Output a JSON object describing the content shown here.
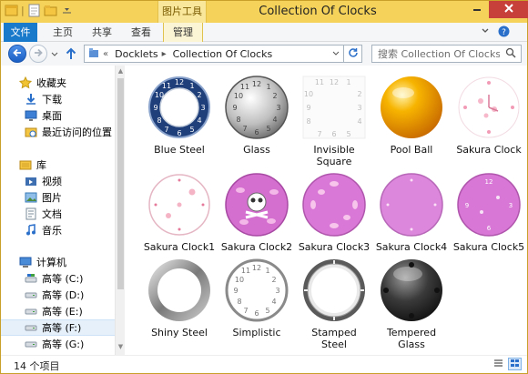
{
  "window": {
    "title": "Collection Of Clocks",
    "contextual_tab_group": "图片工具"
  },
  "ribbon": {
    "tabs": [
      {
        "label": "文件"
      },
      {
        "label": "主页"
      },
      {
        "label": "共享"
      },
      {
        "label": "查看"
      },
      {
        "label": "管理"
      }
    ]
  },
  "address": {
    "overflow": "«",
    "crumbs": [
      "Docklets",
      "Collection Of Clocks"
    ]
  },
  "search": {
    "placeholder": "搜索 Collection Of Clocks"
  },
  "sidebar": {
    "favorites": {
      "label": "收藏夹",
      "items": [
        {
          "label": "下载"
        },
        {
          "label": "桌面"
        },
        {
          "label": "最近访问的位置"
        }
      ]
    },
    "libraries": {
      "label": "库",
      "items": [
        {
          "label": "视频"
        },
        {
          "label": "图片"
        },
        {
          "label": "文档"
        },
        {
          "label": "音乐"
        }
      ]
    },
    "computer": {
      "label": "计算机",
      "items": [
        {
          "label": "高等 (C:)"
        },
        {
          "label": "高等 (D:)"
        },
        {
          "label": "高等 (E:)"
        },
        {
          "label": "高等 (F:)"
        },
        {
          "label": "高等 (G:)"
        }
      ]
    }
  },
  "files": [
    {
      "label": "Blue Steel",
      "style": "bluesteel"
    },
    {
      "label": "Glass",
      "style": "glass"
    },
    {
      "label": "Invisible Square",
      "style": "invisible"
    },
    {
      "label": "Pool Ball",
      "style": "poolball"
    },
    {
      "label": "Sakura Clock",
      "style": "sakura"
    },
    {
      "label": "Sakura Clock1",
      "style": "sakura1"
    },
    {
      "label": "Sakura Clock2",
      "style": "sakura2"
    },
    {
      "label": "Sakura Clock3",
      "style": "sakura3"
    },
    {
      "label": "Sakura Clock4",
      "style": "sakura4"
    },
    {
      "label": "Sakura Clock5",
      "style": "sakura5"
    },
    {
      "label": "Shiny Steel",
      "style": "shiny"
    },
    {
      "label": "Simplistic",
      "style": "simplistic"
    },
    {
      "label": "Stamped Steel",
      "style": "stamped"
    },
    {
      "label": "Tempered Glass",
      "style": "tempered"
    }
  ],
  "status": {
    "item_count": "14 个项目"
  },
  "colors": {
    "file_tab": "#1979ca",
    "title_bar": "#f5d35a",
    "selected_nav": "#e5f0fb"
  },
  "icons": [
    "app-icon",
    "save-icon",
    "new-folder-icon",
    "minimize-icon",
    "maximize-icon",
    "close-icon",
    "help-icon",
    "back-icon",
    "forward-icon",
    "up-icon",
    "refresh-icon",
    "search-icon",
    "details-view-icon",
    "large-icons-view-icon"
  ]
}
